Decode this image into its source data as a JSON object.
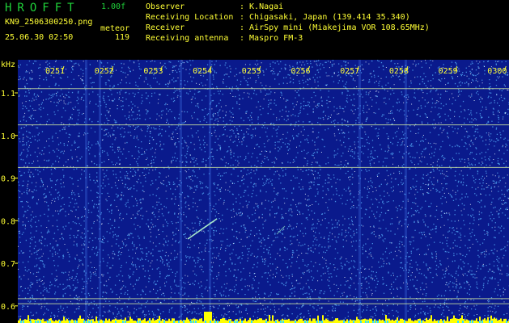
{
  "header": {
    "app_title": "HROFFT",
    "version": "1.00f",
    "filename": "KN9_2506300250.png",
    "mode": "meteor",
    "datetime": "25.06.30 02:50",
    "count": "119"
  },
  "info": [
    {
      "key": "Observer",
      "value": ": K.Nagai"
    },
    {
      "key": "Receiving Location",
      "value": ": Chigasaki, Japan (139.414 35.340)"
    },
    {
      "key": "Receiver",
      "value": ": AirSpy mini (Miakejima VOR 108.65MHz)"
    },
    {
      "key": "Receiving antenna",
      "value": ": Maspro FM-3"
    }
  ],
  "plot": {
    "unit_label": "kHz",
    "time_ticks": [
      "0251",
      "0252",
      "0253",
      "0254",
      "0255",
      "0256",
      "0257",
      "0258",
      "0259",
      "0300"
    ],
    "freq_ticks": [
      "1.1",
      "1.0",
      "0.9",
      "0.8",
      "0.7",
      "0.6"
    ],
    "freq_values": [
      1.1,
      1.0,
      0.9,
      0.8,
      0.7,
      0.6
    ],
    "freq_range": [
      0.575,
      1.155
    ],
    "carrier_lines_khz": [
      1.11,
      1.025,
      0.925,
      0.617,
      0.605
    ],
    "colors": {
      "background": "#0a1a8c",
      "noise_bright": "#5ab4ff",
      "noise_white": "#e8f6ff",
      "line": "#d8f0a0",
      "label": "#ffff35",
      "bottom_bar": "#ffff00"
    }
  }
}
